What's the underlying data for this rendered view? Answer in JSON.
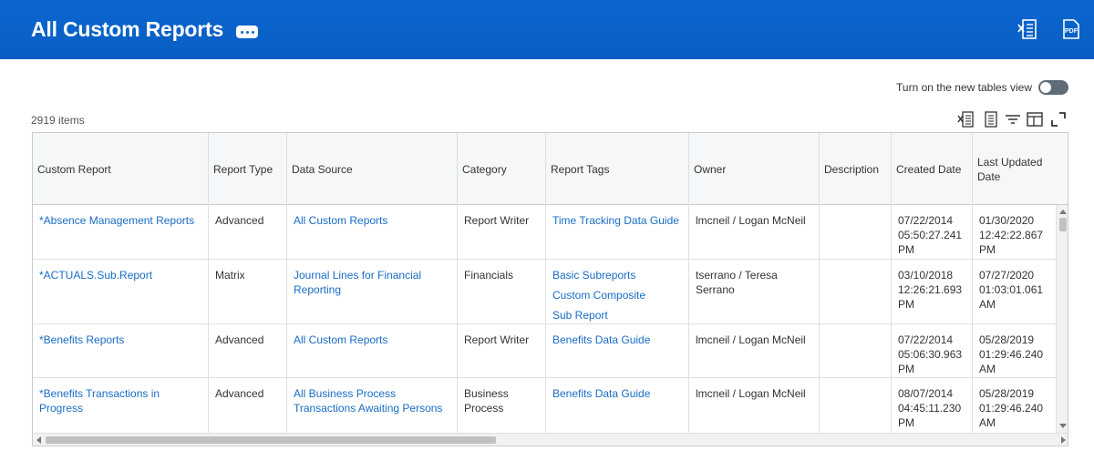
{
  "header": {
    "title": "All Custom Reports",
    "icons": [
      "related-actions-icon",
      "export-excel-icon",
      "export-pdf-icon"
    ],
    "pdf_label": "PDF"
  },
  "toolbar": {
    "toggle_label": "Turn on the new tables view",
    "toggle_on": false,
    "items_count": "2919 items",
    "icons": [
      "excel-export-icon",
      "view-details-icon",
      "filter-icon",
      "columns-icon",
      "fullscreen-icon"
    ]
  },
  "table": {
    "columns": [
      "Custom Report",
      "Report Type",
      "Data Source",
      "Category",
      "Report Tags",
      "Owner",
      "Description",
      "Created Date",
      "Last Updated Date"
    ],
    "rows": [
      {
        "custom_report": "*Absence Management Reports",
        "report_type": "Advanced",
        "data_source": "All Custom Reports",
        "category": "Report Writer",
        "tags": [
          "Time Tracking Data Guide"
        ],
        "owner": "lmcneil / Logan McNeil",
        "description": "",
        "created": "07/22/2014 05:50:27.241 PM",
        "updated": "01/30/2020 12:42:22.867 PM"
      },
      {
        "custom_report": "*ACTUALS.Sub.Report",
        "report_type": "Matrix",
        "data_source": "Journal Lines for Financial Reporting",
        "category": "Financials",
        "tags": [
          "Basic Subreports",
          "Custom Composite",
          "Sub Report"
        ],
        "owner": "tserrano / Teresa Serrano",
        "description": "",
        "created": "03/10/2018 12:26:21.693 PM",
        "updated": "07/27/2020 01:03:01.061 AM"
      },
      {
        "custom_report": "*Benefits Reports",
        "report_type": "Advanced",
        "data_source": "All Custom Reports",
        "category": "Report Writer",
        "tags": [
          "Benefits Data Guide"
        ],
        "owner": "lmcneil / Logan McNeil",
        "description": "",
        "created": "07/22/2014 05:06:30.963 PM",
        "updated": "05/28/2019 01:29:46.240 AM"
      },
      {
        "custom_report": "*Benefits Transactions in Progress",
        "report_type": "Advanced",
        "data_source": "All Business Process Transactions Awaiting Persons",
        "category": "Business Process",
        "tags": [
          "Benefits Data Guide"
        ],
        "owner": "lmcneil / Logan McNeil",
        "description": "",
        "created": "08/07/2014 04:45:11.230 PM",
        "updated": "05/28/2019 01:29:46.240 AM"
      }
    ]
  },
  "colors": {
    "header_blue": "#0b66cf",
    "link": "#1a6cc4",
    "toggle_off": "#606b78"
  }
}
